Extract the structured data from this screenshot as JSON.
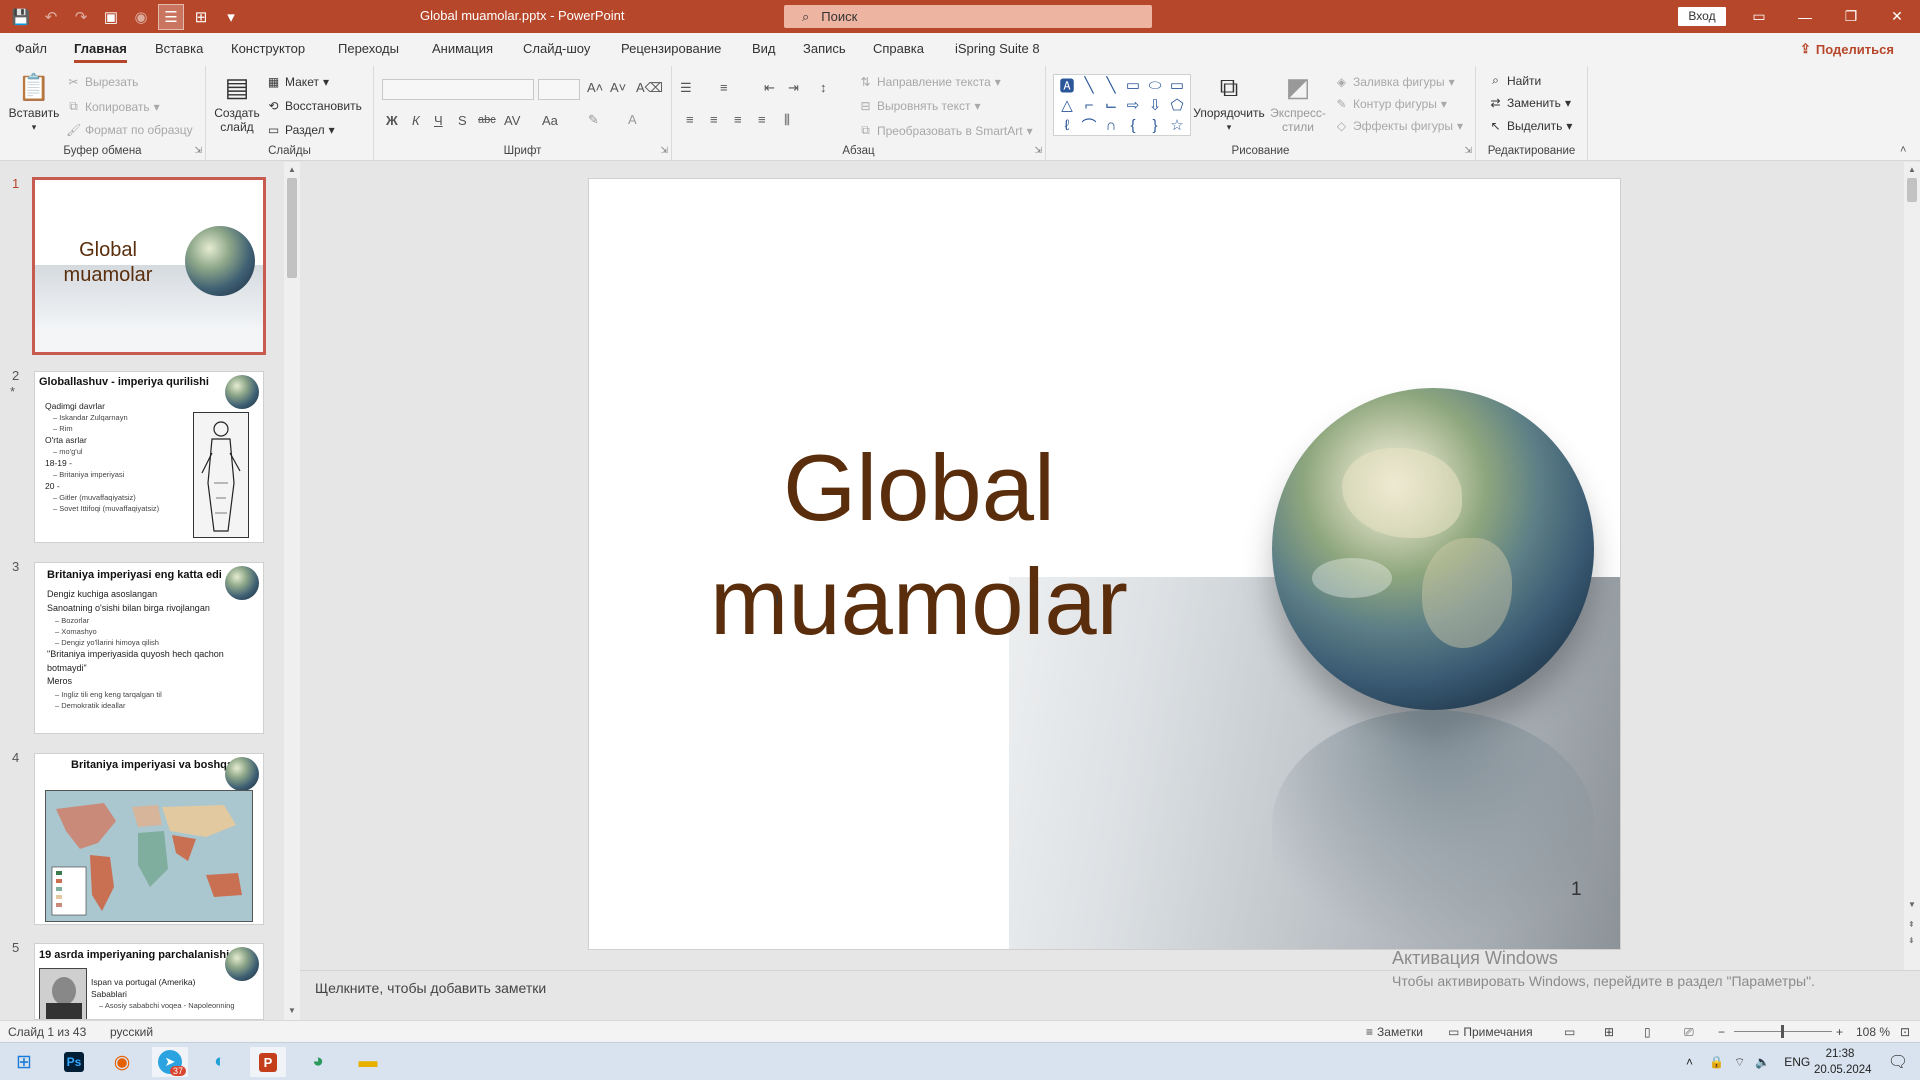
{
  "titlebar": {
    "doc_title": "Global muamolar.pptx - PowerPoint",
    "search_placeholder": "Поиск",
    "signin_label": "Вход",
    "colors": {
      "accent": "#b7472a"
    }
  },
  "menu": {
    "tabs": [
      "Файл",
      "Главная",
      "Вставка",
      "Конструктор",
      "Переходы",
      "Анимация",
      "Слайд-шоу",
      "Рецензирование",
      "Вид",
      "Запись",
      "Справка",
      "iSpring Suite 8"
    ],
    "active_tab": "Главная",
    "share_label": "Поделиться"
  },
  "ribbon": {
    "clipboard": {
      "paste": "Вставить",
      "cut": "Вырезать",
      "copy": "Копировать",
      "format_painter": "Формат по образцу",
      "label": "Буфер обмена"
    },
    "slides": {
      "new_slide_line1": "Создать",
      "new_slide_line2": "слайд",
      "layout": "Макет",
      "reset": "Восстановить",
      "section": "Раздел",
      "label": "Слайды"
    },
    "font": {
      "label": "Шрифт",
      "bold": "Ж",
      "italic": "К",
      "underline": "Ч",
      "shadow": "S",
      "strike": "abc",
      "spacing": "AV",
      "case": "Aa"
    },
    "paragraph": {
      "text_direction": "Направление текста",
      "align_text": "Выровнять текст",
      "smartart": "Преобразовать в SmartArt",
      "label": "Абзац"
    },
    "drawing": {
      "arrange": "Упорядочить",
      "quick_styles_line1": "Экспресс-",
      "quick_styles_line2": "стили",
      "shape_fill": "Заливка фигуры",
      "shape_outline": "Контур фигуры",
      "shape_effects": "Эффекты фигуры",
      "label": "Рисование"
    },
    "editing": {
      "find": "Найти",
      "replace": "Заменить",
      "select": "Выделить",
      "label": "Редактирование"
    }
  },
  "thumbnails": [
    {
      "num": "1",
      "title_line1": "Global",
      "title_line2": "muamolar"
    },
    {
      "num": "2",
      "title": "Globallashuv - imperiya qurilishi",
      "lines": [
        "Qadimgi davrlar",
        "– Iskandar Zulqarnayn",
        "– Rim",
        "O'rta asrlar",
        "– mo'g'ul",
        "18-19 - ",
        "– Britaniya imperiyasi",
        "20 - ",
        "– Gitler (muvaffaqiyatsiz)",
        "– Sovet Ittifoqi (muvaffaqiyatsiz)"
      ]
    },
    {
      "num": "3",
      "title": "Britaniya imperiyasi eng katta edi",
      "lines": [
        "Dengiz kuchiga asoslangan",
        "Sanoatning o'sishi bilan birga rivojlangan",
        "– Bozorlar",
        "– Xomashyo",
        "– Dengiz yo'llarini himoya qilish",
        "\"Britaniya imperiyasida quyosh hech qachon botmaydi\"",
        "Meros",
        "– Ingliz tili eng keng tarqalgan til",
        "– Demokratik ideallar"
      ]
    },
    {
      "num": "4",
      "title": "Britaniya imperiyasi va boshqalar"
    },
    {
      "num": "5",
      "title": "19 asrda imperiyaning parchalanishi",
      "lines": [
        "Ispan va portugal (Amerika)",
        "Sabablari",
        "– Asosiy sababchi voqea - Napoleonning"
      ]
    }
  ],
  "slide": {
    "title_line1": "Global",
    "title_line2": "muamolar",
    "slide_number": "1"
  },
  "notes_placeholder": "Щелкните, чтобы добавить заметки",
  "activation": {
    "line1": "Активация Windows",
    "line2": "Чтобы активировать Windows, перейдите в раздел \"Параметры\"."
  },
  "status": {
    "slide_info": "Слайд 1 из 43",
    "language": "русский",
    "notes": "Заметки",
    "comments": "Примечания",
    "zoom": "108 %"
  },
  "taskbar": {
    "telegram_badge": "37",
    "lang": "ENG",
    "time": "21:38",
    "date": "20.05.2024"
  }
}
